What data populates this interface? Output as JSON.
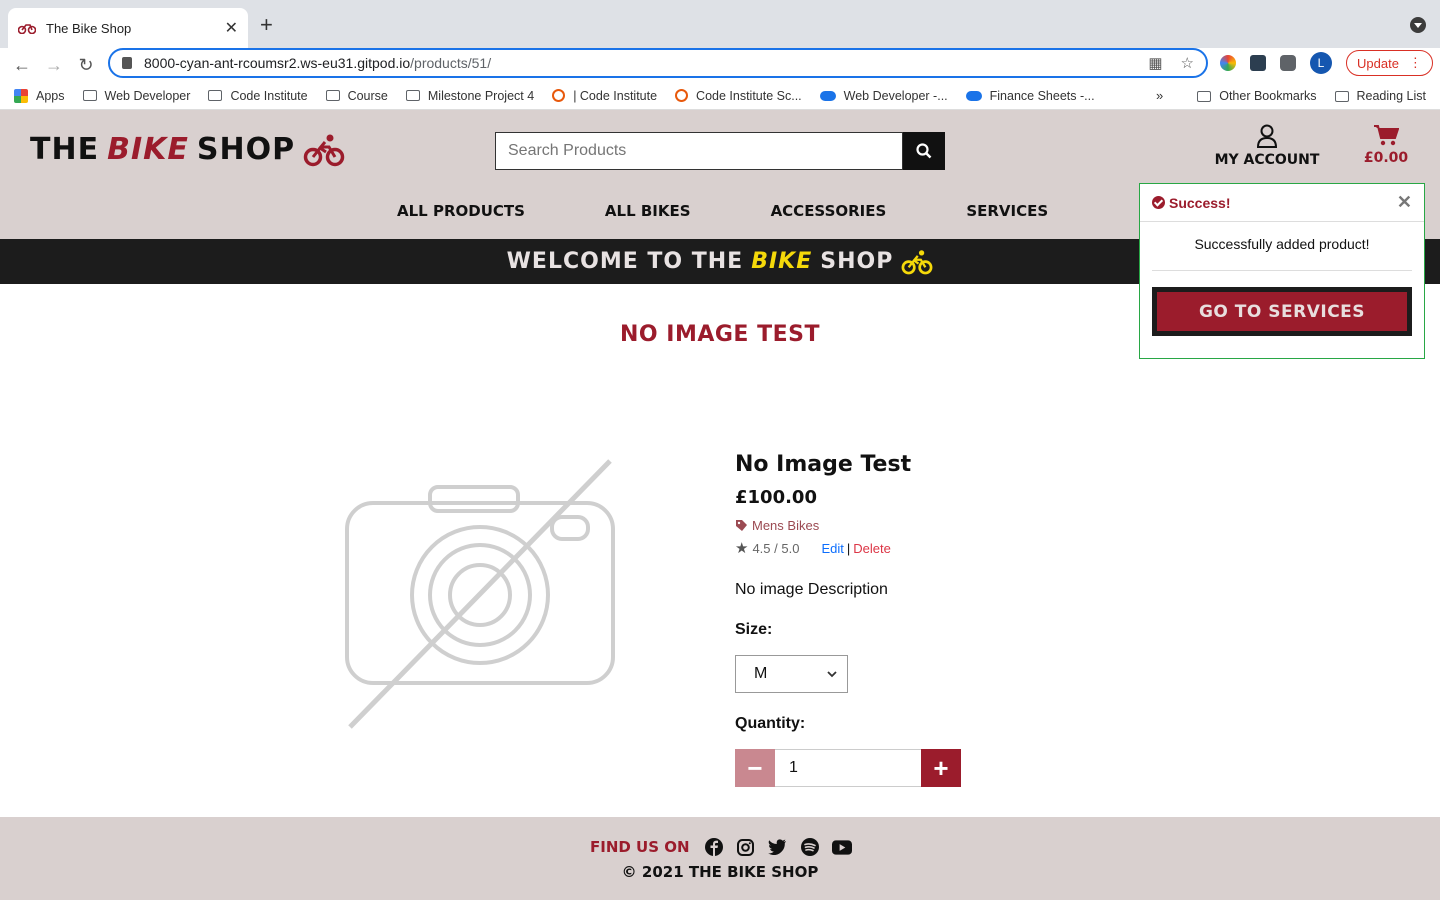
{
  "browser": {
    "tab_title": "The Bike Shop",
    "url_host": "8000-cyan-ant-rcoumsr2.ws-eu31.gitpod.io",
    "url_path": "/products/51/",
    "profile_initial": "L",
    "update_label": "Update",
    "bookmarks": [
      "Apps",
      "Web Developer",
      "Code Institute",
      "Course",
      "Milestone Project 4",
      "| Code Institute",
      "Code Institute Sc...",
      "Web Developer -...",
      "Finance Sheets -..."
    ],
    "bookmarks_right": [
      "Other Bookmarks",
      "Reading List"
    ]
  },
  "site": {
    "logo_the": "THE",
    "logo_bike": "BIKE",
    "logo_shop": "SHOP",
    "search_placeholder": "Search Products",
    "account_label": "MY ACCOUNT",
    "cart_total": "£0.00",
    "nav": [
      "ALL PRODUCTS",
      "ALL BIKES",
      "ACCESSORIES",
      "SERVICES"
    ],
    "banner_pre": "WELCOME TO THE",
    "banner_bike": "BIKE",
    "banner_shop": "SHOP",
    "brand_color": "#9b1c2c",
    "accent_yellow": "#f5d90a"
  },
  "page": {
    "heading": "NO IMAGE TEST"
  },
  "product": {
    "name": "No Image Test",
    "price": "£100.00",
    "category": "Mens Bikes",
    "rating": "4.5 / 5.0",
    "edit_label": "Edit",
    "separator": "|",
    "delete_label": "Delete",
    "description": "No image Description",
    "size_label": "Size:",
    "size_value": "M",
    "quantity_label": "Quantity:",
    "quantity_value": "1"
  },
  "toast": {
    "title": "Success!",
    "message": "Successfully added product!",
    "button_label": "GO TO SERVICES"
  },
  "footer": {
    "find_us": "FIND US ON",
    "copyright": "© 2021 THE BIKE SHOP",
    "social_icons": [
      "facebook-icon",
      "instagram-icon",
      "twitter-icon",
      "spotify-icon",
      "youtube-icon"
    ]
  }
}
